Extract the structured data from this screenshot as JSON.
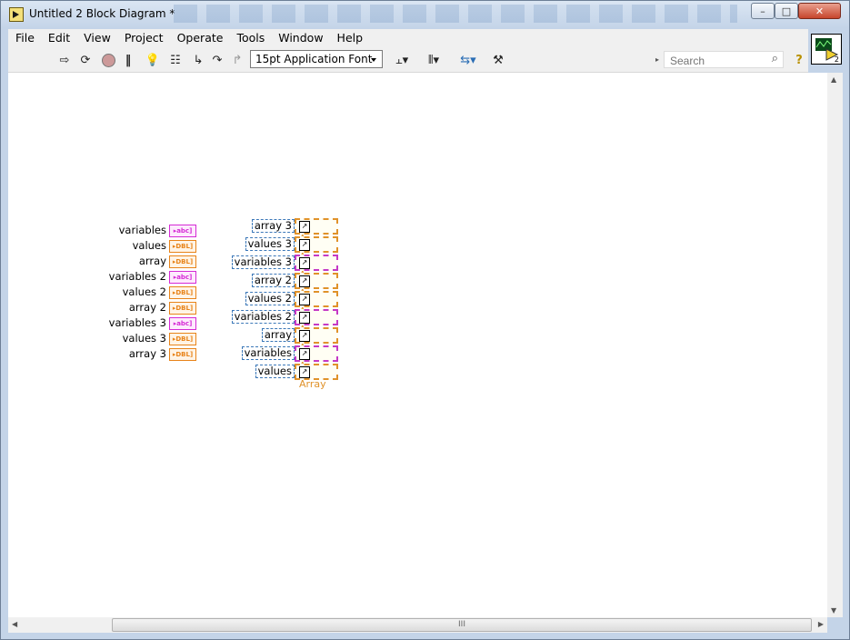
{
  "window": {
    "title": "Untitled 2 Block Diagram *",
    "controls": {
      "minimize": "–",
      "restore": "□",
      "close": "✕"
    }
  },
  "menu": [
    "File",
    "Edit",
    "View",
    "Project",
    "Operate",
    "Tools",
    "Window",
    "Help"
  ],
  "toolbar": {
    "font_value": "15pt Application Font",
    "search_placeholder": "Search",
    "icons": [
      "run-arrow-icon",
      "run-continuously-icon",
      "abort-icon",
      "pause-icon",
      "highlight-execution-icon",
      "retain-wire-values-icon",
      "step-into-icon",
      "step-over-icon",
      "step-out-icon",
      "align-objects-icon",
      "distribute-objects-icon",
      "reorder-icon",
      "clean-up-diagram-icon",
      "search-icon",
      "help-icon"
    ]
  },
  "vi_icon_label": "2",
  "controls": [
    {
      "label": "variables",
      "type": "abc"
    },
    {
      "label": "values",
      "type": "DBL"
    },
    {
      "label": "array",
      "type": "DBL"
    },
    {
      "label": "variables 2",
      "type": "abc"
    },
    {
      "label": "values 2",
      "type": "DBL"
    },
    {
      "label": "array 2",
      "type": "DBL"
    },
    {
      "label": "variables 3",
      "type": "abc"
    },
    {
      "label": "values 3",
      "type": "DBL"
    },
    {
      "label": "array 3",
      "type": "DBL"
    }
  ],
  "property_nodes": [
    {
      "label": "array 3",
      "property": "Array",
      "kind": "dbl"
    },
    {
      "label": "values 3",
      "property": "Array",
      "kind": "dbl"
    },
    {
      "label": "variables 3",
      "property": "Array",
      "kind": "str"
    },
    {
      "label": "array 2",
      "property": "Array",
      "kind": "dbl"
    },
    {
      "label": "values 2",
      "property": "Array",
      "kind": "dbl"
    },
    {
      "label": "variables 2",
      "property": "Array",
      "kind": "str"
    },
    {
      "label": "array",
      "property": "Array",
      "kind": "dbl"
    },
    {
      "label": "variables",
      "property": "Array",
      "kind": "str"
    },
    {
      "label": "values",
      "property": "Array",
      "kind": "dbl"
    }
  ],
  "scroll_grip": "III"
}
